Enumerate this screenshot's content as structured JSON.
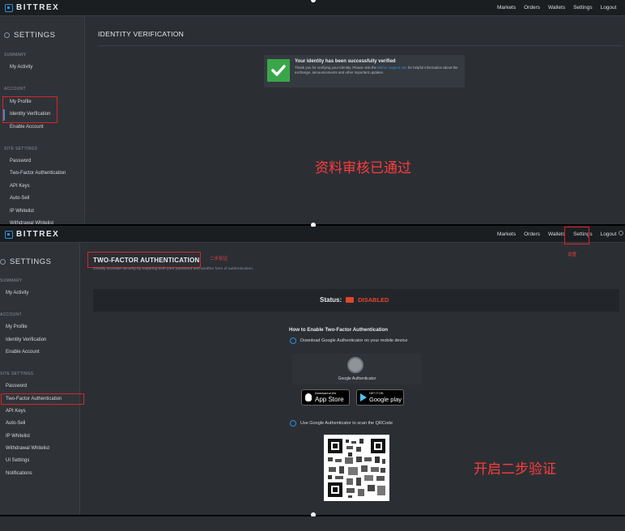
{
  "brand": "BITTREX",
  "nav": [
    "Markets",
    "Orders",
    "Wallets",
    "Settings",
    "Logout"
  ],
  "sidebar": {
    "title": "SETTINGS",
    "sections": {
      "summary": "SUMMARY",
      "account": "ACCOUNT",
      "site_settings": "SITE SETTINGS"
    },
    "summary_items": [
      "My Activity"
    ],
    "account_items": [
      "My Profile",
      "Identity Verification",
      "Enable Account"
    ],
    "site_items": [
      "Password",
      "Two-Factor Authentication",
      "API Keys",
      "Auto-Sell",
      "IP Whitelist",
      "Withdrawal Whitelist",
      "UI Settings",
      "Notifications"
    ]
  },
  "identity": {
    "heading": "IDENTITY VERIFICATION",
    "success_title": "Your identity has been successfully verified",
    "success_text_1": "Thank you for verifying your identity. Please visit the",
    "success_link": "Bittrex support site",
    "success_text_2": "for helpful information about the exchange, announcements and other important updates.",
    "annotation": "资料审核已通过"
  },
  "twofa": {
    "heading": "TWO-FACTOR AUTHENTICATION",
    "heading_note": "二步验证",
    "subtitle": "Greatly increase security by requiring both your password and another form of authentication.",
    "status_label": "Status:",
    "status_value": "DISABLED",
    "how_title": "How to Enable Two-Factor Authentication",
    "step1": "Download Google Authenticator on your mobile device",
    "ga_label": "Google Authenticator",
    "appstore_small": "Download on the",
    "appstore_big": "App Store",
    "gplay_small": "GET IT ON",
    "gplay_big": "Google play",
    "step2": "Use Google Authenticator to scan the QRCode",
    "settings_note": "设置",
    "annotation": "开启二步验证"
  },
  "colors": {
    "accent": "#2f8fd8",
    "success": "#3aa64a",
    "danger": "#e0452b",
    "annotation": "#ff3b3b"
  }
}
